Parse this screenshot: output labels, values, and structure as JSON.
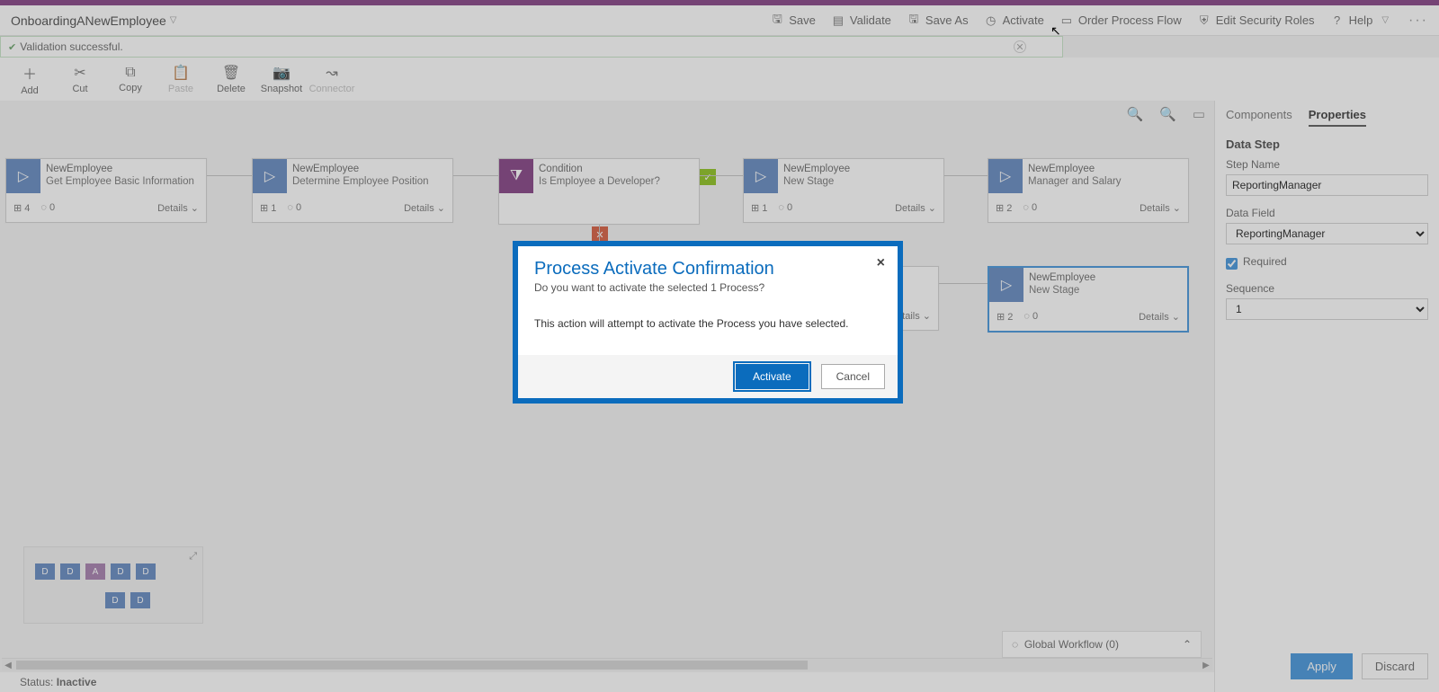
{
  "header": {
    "process_name": "OnboardingANewEmployee",
    "actions": {
      "save": "Save",
      "validate": "Validate",
      "save_as": "Save As",
      "activate": "Activate",
      "order": "Order Process Flow",
      "security": "Edit Security Roles",
      "help": "Help"
    }
  },
  "validation": {
    "message": "Validation successful."
  },
  "toolbar": {
    "add": "Add",
    "cut": "Cut",
    "copy": "Copy",
    "paste": "Paste",
    "delete": "Delete",
    "snapshot": "Snapshot",
    "connector": "Connector"
  },
  "stages": [
    {
      "entity": "NewEmployee",
      "name": "Get Employee Basic Information",
      "steps": "4",
      "wf": "0"
    },
    {
      "entity": "NewEmployee",
      "name": "Determine Employee Position",
      "steps": "1",
      "wf": "0"
    },
    {
      "entity": "Condition",
      "name": "Is Employee a Developer?",
      "type": "condition"
    },
    {
      "entity": "NewEmployee",
      "name": "New Stage",
      "steps": "1",
      "wf": "0"
    },
    {
      "entity": "NewEmployee",
      "name": "Manager and Salary",
      "steps": "2",
      "wf": "0"
    },
    {
      "entity": "NewEmployee",
      "name": "New Stage",
      "steps": "2",
      "wf": "0",
      "selected": true
    }
  ],
  "details_label": "Details",
  "global_workflow": "Global Workflow (0)",
  "status": {
    "label": "Status:",
    "value": "Inactive"
  },
  "right_panel": {
    "tabs": {
      "components": "Components",
      "properties": "Properties"
    },
    "section": "Data Step",
    "step_name_label": "Step Name",
    "step_name_value": "ReportingManager",
    "data_field_label": "Data Field",
    "data_field_value": "ReportingManager",
    "required_label": "Required",
    "sequence_label": "Sequence",
    "sequence_value": "1",
    "apply": "Apply",
    "discard": "Discard"
  },
  "modal": {
    "title": "Process Activate Confirmation",
    "subtitle": "Do you want to activate the selected 1 Process?",
    "body": "This action will attempt to activate the Process you have selected.",
    "activate": "Activate",
    "cancel": "Cancel"
  }
}
